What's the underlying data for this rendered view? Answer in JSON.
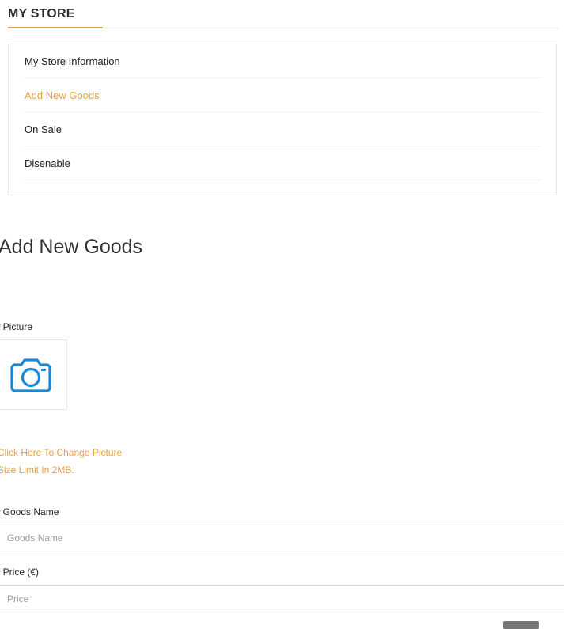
{
  "store": {
    "title": "MY STORE"
  },
  "menu": {
    "items": [
      {
        "label": "My Store Information",
        "active": false
      },
      {
        "label": "Add New Goods",
        "active": true
      },
      {
        "label": "On Sale",
        "active": false
      },
      {
        "label": "Disenable",
        "active": false
      }
    ]
  },
  "main": {
    "heading": "Add New Goods",
    "picture": {
      "required_mark": "*",
      "label": "Picture",
      "icon": "camera-icon",
      "change_link": "Click Here To Change Picture",
      "size_note": "Size Limit In 2MB."
    },
    "goods_name": {
      "required_mark": "*",
      "label": "Goods Name",
      "value": "",
      "placeholder": "Goods Name"
    },
    "price": {
      "required_mark": "*",
      "label": "Price  (€)",
      "value": "",
      "placeholder": "Price"
    }
  },
  "colors": {
    "accent": "#e3a14a",
    "icon_blue": "#1a88d6",
    "border": "#e4e4e4"
  }
}
